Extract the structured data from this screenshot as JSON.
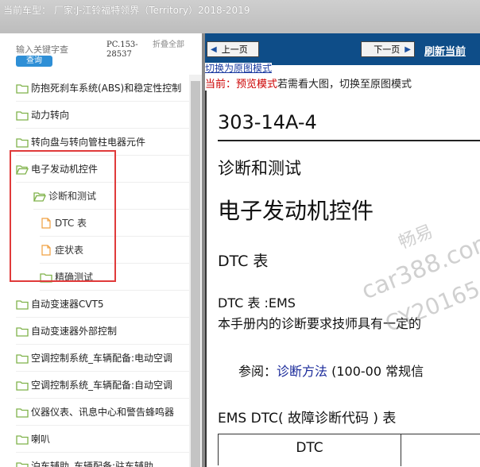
{
  "window": {
    "title": "当前车型：  厂家:J-江铃福特领界（Territory）2018-2019"
  },
  "sidebar": {
    "search_placeholder": "输入关键字查",
    "search_button": "查询",
    "code": "PC.153-28537",
    "collapse_all": "折叠全部",
    "items": [
      {
        "label": "防抱死刹车系统(ABS)和稳定性控制",
        "level": 0,
        "open": false
      },
      {
        "label": "动力转向",
        "level": 0,
        "open": false
      },
      {
        "label": "转向盘与转向管柱电器元件",
        "level": 0,
        "open": false
      },
      {
        "label": "电子发动机控件",
        "level": 0,
        "open": true
      },
      {
        "label": "诊断和测试",
        "level": 1,
        "open": true
      },
      {
        "label": "DTC 表",
        "level": 2,
        "doc": true
      },
      {
        "label": "症状表",
        "level": 2,
        "doc": true
      },
      {
        "label": "精确测试",
        "level": 2,
        "folder": true
      },
      {
        "label": "自动变速器CVT5",
        "level": 0,
        "open": false
      },
      {
        "label": "自动变速器外部控制",
        "level": 0,
        "open": false
      },
      {
        "label": "空调控制系统_车辆配备:电动空调",
        "level": 0,
        "open": false
      },
      {
        "label": "空调控制系统_车辆配备:自动空调",
        "level": 0,
        "open": false
      },
      {
        "label": "仪器仪表、讯息中心和警告蜂鸣器",
        "level": 0,
        "open": false
      },
      {
        "label": "喇叭",
        "level": 0,
        "open": false
      },
      {
        "label": "泊车辅助_车辆配备:驻车辅助",
        "level": 0,
        "open": false
      }
    ]
  },
  "nav": {
    "prev": "上一页",
    "next": "下一页",
    "refresh": "刷新当前"
  },
  "mode": {
    "switch_link": "切换为原图模式",
    "current_label": "当前：预览模式",
    "hint": "若需看大图，切换至原图模式"
  },
  "doc": {
    "code": "303-14A-4",
    "section": "诊断和测试",
    "title": "电子发动机控件",
    "subtitle": "DTC 表",
    "ems_heading": "DTC 表 :EMS",
    "paragraph": "本手册内的诊断要求技师具有一定的",
    "ref_prefix": "参阅：",
    "ref_link": "诊断方法",
    "ref_suffix": " (100-00 常规信",
    "table_heading": "EMS DTC( 故障诊断代码 ) 表",
    "table_header": "DTC"
  },
  "watermark": {
    "line1": "畅易",
    "line2": "car388.com",
    "line3": "CY20165"
  },
  "colors": {
    "nav_bg": "#0e4d88",
    "highlight_box": "#e03a3a",
    "folder_green": "#7fb24a",
    "doc_orange": "#f0a040"
  }
}
